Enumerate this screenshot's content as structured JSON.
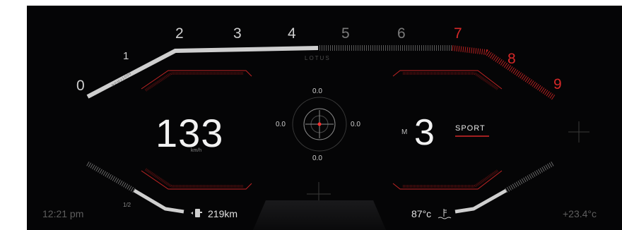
{
  "tachometer": {
    "labels": [
      "0",
      "1",
      "2",
      "3",
      "4",
      "5",
      "6",
      "7",
      "8",
      "9"
    ],
    "unit": "RPMx1000",
    "redline_from": 7,
    "red_color": "#d62828",
    "bar_color": "#cfcfcf"
  },
  "brand": "LOTUS",
  "speed": {
    "value": "133",
    "unit": "km/h"
  },
  "gforce": {
    "top": "0.0",
    "left": "0.0",
    "right": "0.0",
    "bottom": "0.0"
  },
  "gear": {
    "prefix": "M",
    "value": "3",
    "mode": "SPORT"
  },
  "fuel": {
    "half_label": "1/2",
    "range": "219km",
    "icon": "fuel-pump-icon",
    "level": 0.5
  },
  "coolant": {
    "value": "87°c",
    "icon": "coolant-temp-icon"
  },
  "status": {
    "time": "12:21 pm",
    "outside_temp": "+23.4°c"
  },
  "colors": {
    "accent_red": "#d62828",
    "background": "#050506",
    "text": "#f2f2f2"
  }
}
